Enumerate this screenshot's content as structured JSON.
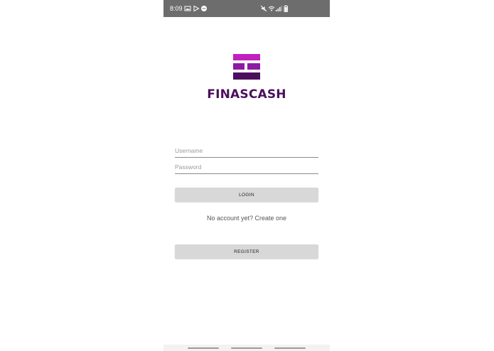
{
  "status_bar": {
    "time": "8:09",
    "left_icons": [
      "image-icon",
      "play-store-icon",
      "message-icon"
    ],
    "right_icons": [
      "mute-icon",
      "wifi-icon",
      "signal-icon",
      "battery-icon"
    ]
  },
  "brand": {
    "name": "FINASCASH",
    "colors": {
      "top": "#c21fbf",
      "middle": "#8d1aa3",
      "bottom": "#4b0e5e"
    }
  },
  "form": {
    "username_placeholder": "Username",
    "password_placeholder": "Password",
    "login_label": "LOGIN",
    "create_account_text": "No account yet? Create one",
    "register_label": "REGISTER"
  },
  "nav_bar": {
    "buttons": [
      "recent-apps-button",
      "home-button",
      "back-button"
    ]
  }
}
